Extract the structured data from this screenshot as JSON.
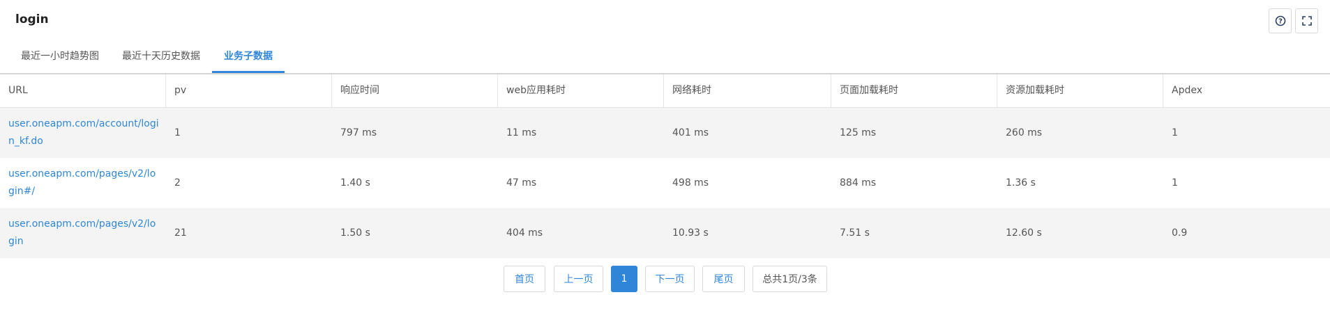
{
  "header": {
    "title": "login",
    "help_icon": "question-circle-icon",
    "fullscreen_icon": "fullscreen-icon"
  },
  "tabs": [
    {
      "label": "最近一小时趋势图",
      "active": false
    },
    {
      "label": "最近十天历史数据",
      "active": false
    },
    {
      "label": "业务子数据",
      "active": true
    }
  ],
  "table": {
    "columns": [
      "URL",
      "pv",
      "响应时间",
      "web应用耗时",
      "网络耗时",
      "页面加载耗时",
      "资源加载耗时",
      "Apdex"
    ],
    "rows": [
      {
        "url": "user.oneapm.com/account/login_kf.do",
        "pv": "1",
        "response": "797 ms",
        "web": "11 ms",
        "network": "401 ms",
        "page_load": "125 ms",
        "resource_load": "260 ms",
        "apdex": "1"
      },
      {
        "url": "user.oneapm.com/pages/v2/login#/",
        "pv": "2",
        "response": "1.40 s",
        "web": "47 ms",
        "network": "498 ms",
        "page_load": "884 ms",
        "resource_load": "1.36 s",
        "apdex": "1"
      },
      {
        "url": "user.oneapm.com/pages/v2/login",
        "pv": "21",
        "response": "1.50 s",
        "web": "404 ms",
        "network": "10.93 s",
        "page_load": "7.51 s",
        "resource_load": "12.60 s",
        "apdex": "0.9"
      }
    ]
  },
  "pagination": {
    "first": "首页",
    "prev": "上一页",
    "current": "1",
    "next": "下一页",
    "last": "尾页",
    "summary": "总共1页/3条"
  },
  "colors": {
    "accent": "#2f86d9",
    "stripe": "#f4f4f4"
  }
}
